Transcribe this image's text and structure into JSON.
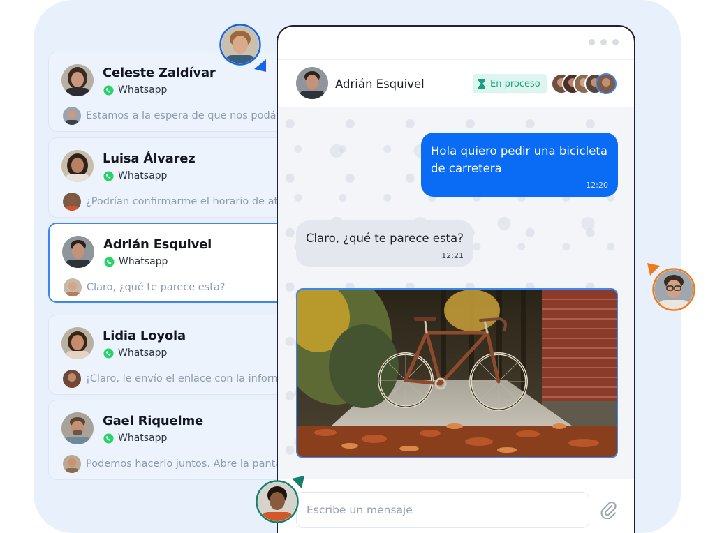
{
  "contacts": [
    {
      "name": "Celeste Zaldívar",
      "channel": "Whatsapp",
      "preview": "Estamos a la espera de que nos podáis"
    },
    {
      "name": "Luisa Álvarez",
      "channel": "Whatsapp",
      "preview": "¿Podrían confirmarme el horario de atención?"
    },
    {
      "name": "Adrián Esquivel",
      "channel": "Whatsapp",
      "preview": "Claro, ¿qué te parece esta?"
    },
    {
      "name": "Lidia Loyola",
      "channel": "Whatsapp",
      "preview": "¡Claro, le envío el enlace con la información"
    },
    {
      "name": "Gael Riquelme",
      "channel": "Whatsapp",
      "preview": "Podemos hacerlo juntos. Abre la pantalla"
    }
  ],
  "chat": {
    "contact_name": "Adrián Esquivel",
    "status": "En proceso",
    "messages": [
      {
        "direction": "outgoing",
        "text": "Hola quiero pedir una bicicleta de carretera",
        "time": "12:20"
      },
      {
        "direction": "incoming",
        "text": "Claro, ¿qué te parece esta?",
        "time": "12:21"
      },
      {
        "direction": "incoming",
        "type": "image",
        "description": "bicycle-photo"
      }
    ],
    "composer": {
      "placeholder": "Escribe un mensaje"
    }
  },
  "colors": {
    "brand_blue": "#0a6cf5",
    "active_border": "#3d86ef",
    "whatsapp_green": "#25d366",
    "status_bg": "#dcf5ee",
    "status_text": "#1aa383",
    "cursor_blue": "#1565e6",
    "cursor_orange": "#f07a1a",
    "cursor_green": "#12806a"
  },
  "icons": {
    "channel": "whatsapp-icon",
    "status": "hourglass-icon",
    "attach": "paperclip-icon",
    "window": "window-dots-icon"
  }
}
